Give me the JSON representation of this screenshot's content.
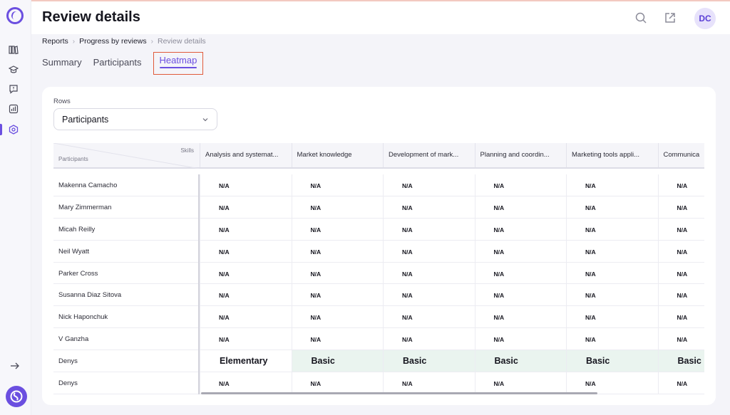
{
  "header": {
    "title": "Review details",
    "avatar_initials": "DC"
  },
  "breadcrumb": [
    "Reports",
    "Progress by reviews",
    "Review details"
  ],
  "tabs": [
    {
      "label": "Summary",
      "active": false
    },
    {
      "label": "Participants",
      "active": false
    },
    {
      "label": "Heatmap",
      "active": true
    }
  ],
  "rows_filter": {
    "label": "Rows",
    "selected": "Participants"
  },
  "table": {
    "corner_skills": "Skills",
    "corner_participants": "Participants",
    "columns": [
      "Analysis and systemat...",
      "Market knowledge",
      "Development of mark...",
      "Planning and coordin...",
      "Marketing tools appli...",
      "Communica"
    ],
    "rows": [
      {
        "name": "Makenna Camacho",
        "cells": [
          "N/A",
          "N/A",
          "N/A",
          "N/A",
          "N/A",
          "N/A"
        ]
      },
      {
        "name": "Mary Zimmerman",
        "cells": [
          "N/A",
          "N/A",
          "N/A",
          "N/A",
          "N/A",
          "N/A"
        ]
      },
      {
        "name": "Micah Reilly",
        "cells": [
          "N/A",
          "N/A",
          "N/A",
          "N/A",
          "N/A",
          "N/A"
        ]
      },
      {
        "name": "Neil Wyatt",
        "cells": [
          "N/A",
          "N/A",
          "N/A",
          "N/A",
          "N/A",
          "N/A"
        ]
      },
      {
        "name": "Parker Cross",
        "cells": [
          "N/A",
          "N/A",
          "N/A",
          "N/A",
          "N/A",
          "N/A"
        ]
      },
      {
        "name": "Susanna Diaz Sitova",
        "cells": [
          "N/A",
          "N/A",
          "N/A",
          "N/A",
          "N/A",
          "N/A"
        ]
      },
      {
        "name": "Nick Haponchuk",
        "cells": [
          "N/A",
          "N/A",
          "N/A",
          "N/A",
          "N/A",
          "N/A"
        ]
      },
      {
        "name": "V Ganzha",
        "cells": [
          "N/A",
          "N/A",
          "N/A",
          "N/A",
          "N/A",
          "N/A"
        ]
      },
      {
        "name": "Denys",
        "cells": [
          "Elementary",
          "Basic",
          "Basic",
          "Basic",
          "Basic",
          "Basic"
        ]
      },
      {
        "name": "Denys",
        "cells": [
          "N/A",
          "N/A",
          "N/A",
          "N/A",
          "N/A",
          "N/A"
        ]
      }
    ]
  },
  "colors": {
    "accent": "#6b4fe0",
    "basic_cell_bg": "#eaf4ef",
    "highlight_border": "#e05a3a"
  },
  "icons": {
    "sidebar": [
      "library-icon",
      "graduation-cap-icon",
      "feedback-icon",
      "analytics-icon",
      "settings-hex-icon"
    ],
    "header": [
      "search-icon",
      "external-link-icon"
    ],
    "sidebar_bottom": [
      "arrow-right-icon",
      "app-logo-icon"
    ]
  }
}
